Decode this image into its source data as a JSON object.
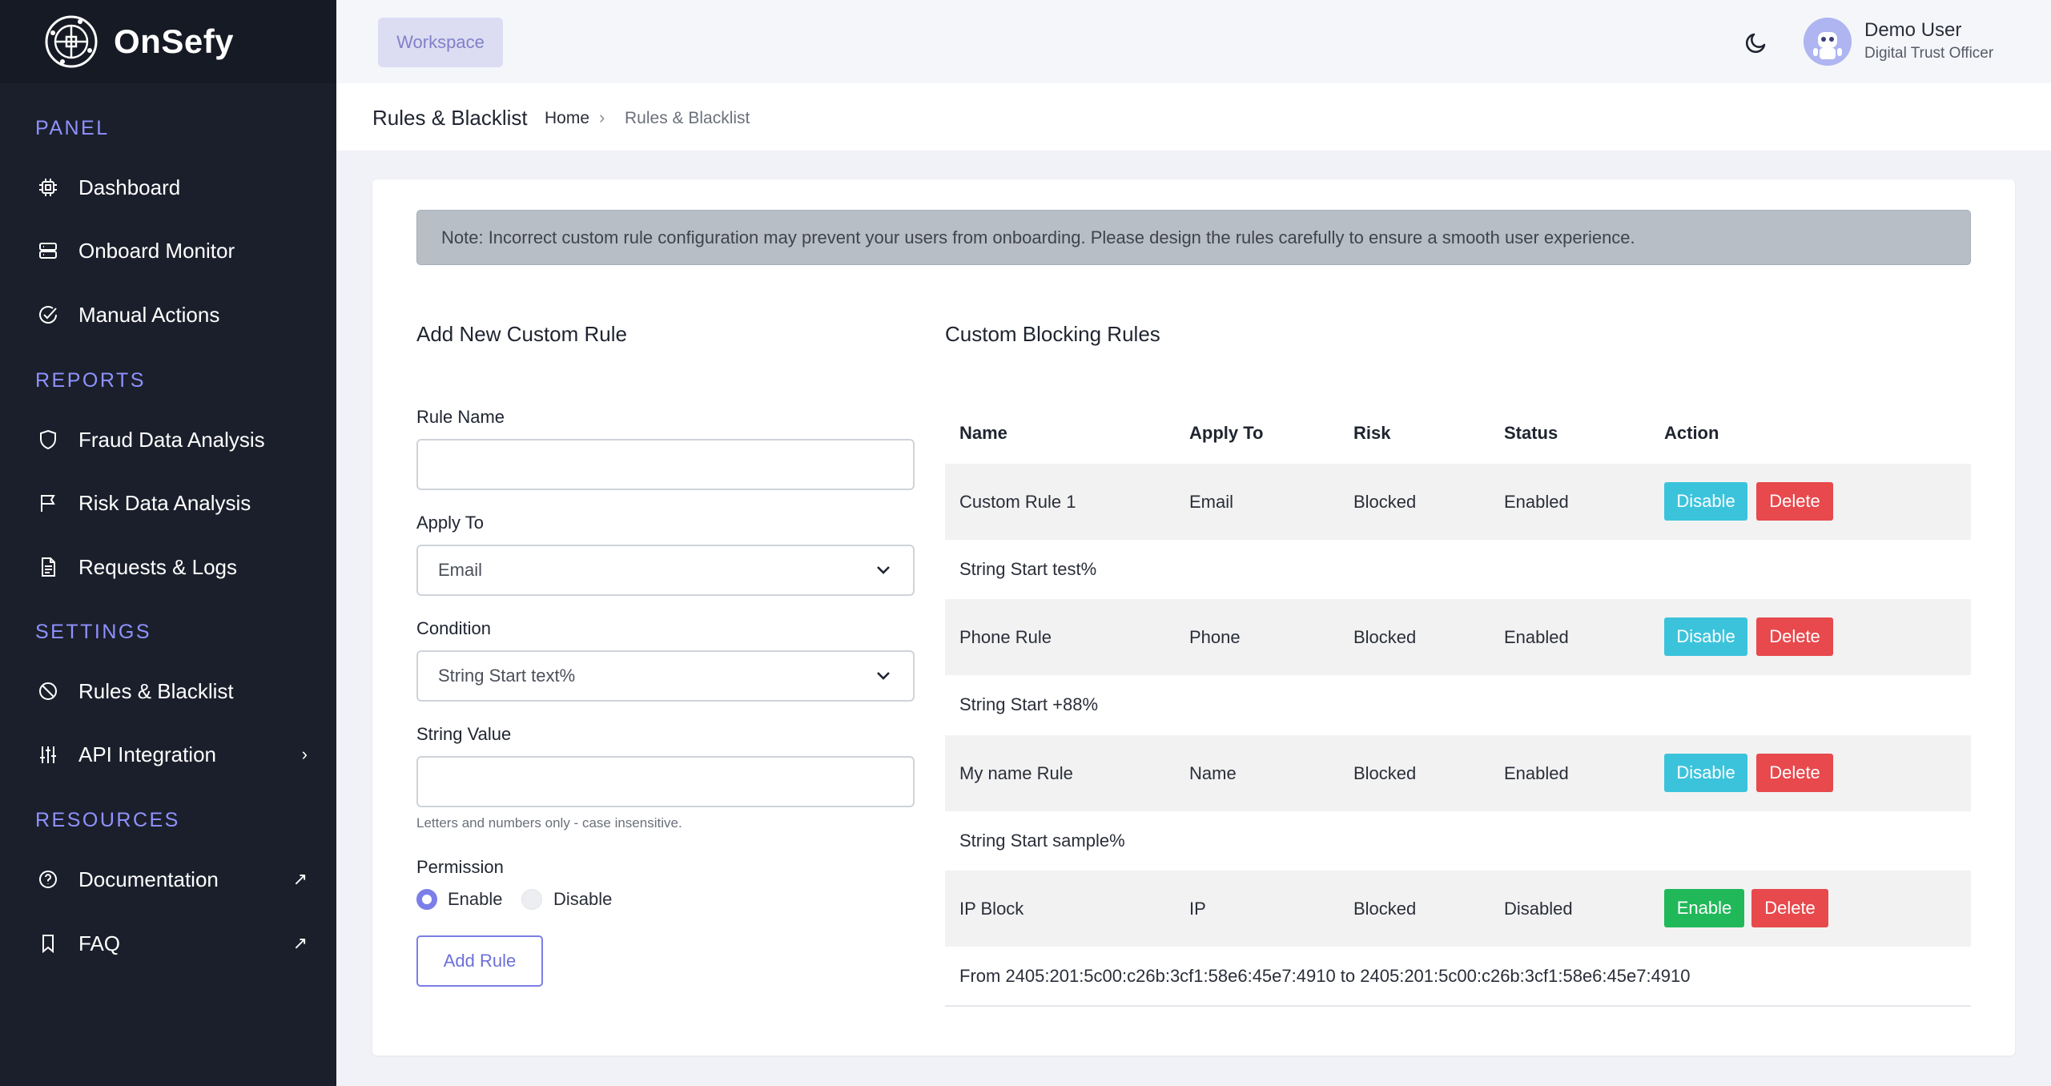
{
  "brand": {
    "name": "OnSefy",
    "logo_icon": "globe-network-icon"
  },
  "sidebar": {
    "sections": [
      {
        "title": "PANEL",
        "items": [
          {
            "label": "Dashboard",
            "icon": "chip-icon"
          },
          {
            "label": "Onboard Monitor",
            "icon": "server-icon"
          },
          {
            "label": "Manual Actions",
            "icon": "check-circle-icon"
          }
        ]
      },
      {
        "title": "REPORTS",
        "items": [
          {
            "label": "Fraud Data Analysis",
            "icon": "shield-icon"
          },
          {
            "label": "Risk Data Analysis",
            "icon": "flag-icon"
          },
          {
            "label": "Requests & Logs",
            "icon": "document-icon"
          }
        ]
      },
      {
        "title": "SETTINGS",
        "items": [
          {
            "label": "Rules & Blacklist",
            "icon": "ban-icon"
          },
          {
            "label": "API Integration",
            "icon": "sliders-icon",
            "trail": "›"
          }
        ]
      },
      {
        "title": "RESOURCES",
        "items": [
          {
            "label": "Documentation",
            "icon": "help-circle-icon",
            "trail": "↗"
          },
          {
            "label": "FAQ",
            "icon": "bookmark-icon",
            "trail": "↗"
          }
        ]
      }
    ]
  },
  "topbar": {
    "workspace_label": "Workspace",
    "user": {
      "name": "Demo User",
      "role": "Digital Trust Officer"
    }
  },
  "breadcrumb": {
    "title": "Rules & Blacklist",
    "home": "Home",
    "separator": "›",
    "current": "Rules & Blacklist"
  },
  "note": "Note: Incorrect custom rule configuration may prevent your users from onboarding. Please design the rules carefully to ensure a smooth user experience.",
  "form": {
    "heading": "Add New Custom Rule",
    "rule_name_label": "Rule Name",
    "rule_name_value": "",
    "apply_to_label": "Apply To",
    "apply_to_value": "Email",
    "condition_label": "Condition",
    "condition_value": "String Start text%",
    "string_value_label": "String Value",
    "string_value_value": "",
    "string_hint": "Letters and numbers only - case insensitive.",
    "permission_label": "Permission",
    "permission_enable": "Enable",
    "permission_disable": "Disable",
    "permission_selected": "Enable",
    "submit_label": "Add Rule"
  },
  "rules_table": {
    "heading": "Custom Blocking Rules",
    "columns": [
      "Name",
      "Apply To",
      "Risk",
      "Status",
      "Action"
    ],
    "rows": [
      {
        "name": "Custom Rule 1",
        "apply_to": "Email",
        "risk": "Blocked",
        "status": "Enabled",
        "toggle_label": "Disable",
        "delete_label": "Delete",
        "condition": "String Start test%"
      },
      {
        "name": "Phone Rule",
        "apply_to": "Phone",
        "risk": "Blocked",
        "status": "Enabled",
        "toggle_label": "Disable",
        "delete_label": "Delete",
        "condition": "String Start +88%"
      },
      {
        "name": "My name Rule",
        "apply_to": "Name",
        "risk": "Blocked",
        "status": "Enabled",
        "toggle_label": "Disable",
        "delete_label": "Delete",
        "condition": "String Start sample%"
      },
      {
        "name": "IP Block",
        "apply_to": "IP",
        "risk": "Blocked",
        "status": "Disabled",
        "toggle_label": "Enable",
        "delete_label": "Delete",
        "condition": "From 2405:201:5c00:c26b:3cf1:58e6:45e7:4910 to 2405:201:5c00:c26b:3cf1:58e6:45e7:4910"
      }
    ]
  },
  "colors": {
    "accent": "#7b7ee8",
    "disable_btn": "#3cc3dc",
    "enable_btn": "#21b85a",
    "delete_btn": "#e7494d",
    "sidebar_bg": "#1b1f2b"
  }
}
